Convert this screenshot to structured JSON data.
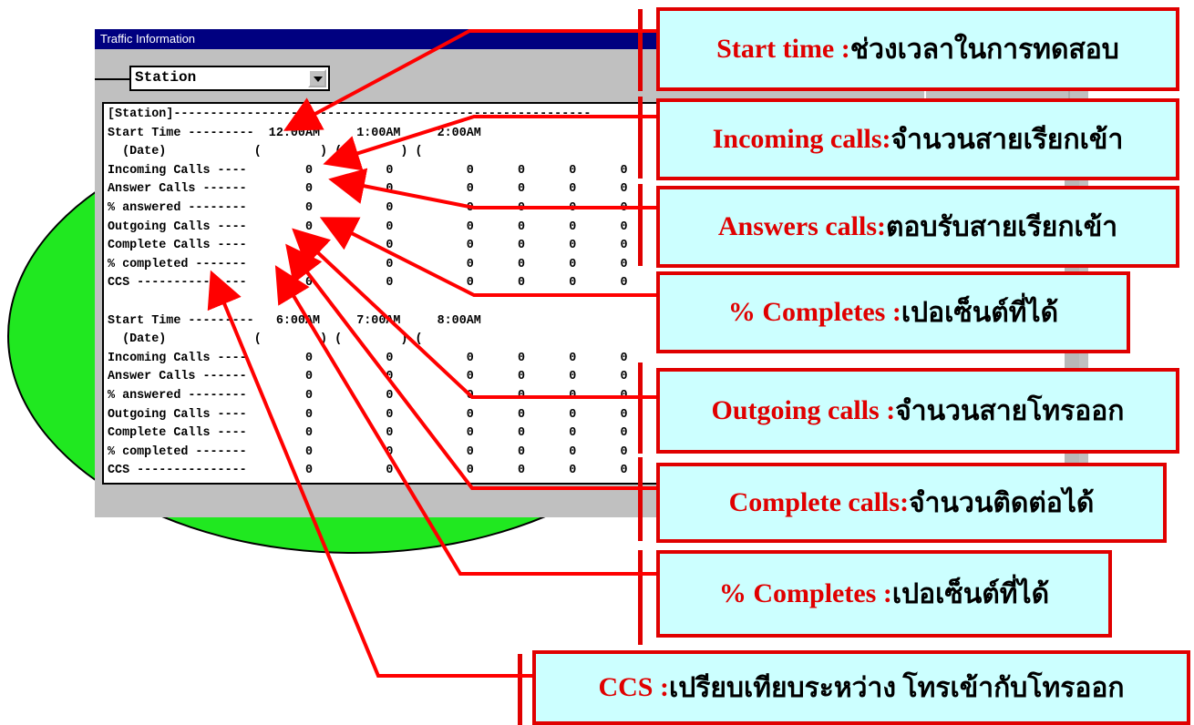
{
  "window": {
    "title": "Traffic Information",
    "station_select_value": "Station",
    "report_lines": [
      "[Station]---------------------------------------------------------",
      "Start Time ---------  12:00AM     1:00AM     2:00AM",
      "  (Date)            (        ) (        ) (",
      "Incoming Calls ----        0          0          0      0      0      0",
      "Answer Calls ------        0          0          0      0      0      0",
      "% answered --------        0          0          0      0      0      0",
      "Outgoing Calls ----        0          0          0      0      0      0",
      "Complete Calls ----        0          0          0      0      0      0",
      "% completed -------        0          0          0      0      0      0",
      "CCS ---------------        0          0          0      0      0      0",
      "",
      "Start Time ---------   6:00AM     7:00AM     8:00AM",
      "  (Date)            (        ) (        ) (",
      "Incoming Calls ----        0          0          0      0      0      0",
      "Answer Calls ------        0          0          0      0      0      0",
      "% answered --------        0          0          0      0      0      0",
      "Outgoing Calls ----        0          0          0      0      0      0",
      "Complete Calls ----        0          0          0      0      0      0",
      "% completed -------        0          0          0      0      0      0",
      "CCS ---------------        0          0          0      0      0      0"
    ]
  },
  "callouts": [
    {
      "term": "Start time :",
      "desc": " ช่วงเวลาในการทดสอบ"
    },
    {
      "term": "Incoming calls:",
      "desc": " จำนวนสายเรียกเข้า"
    },
    {
      "term": "Answers calls:",
      "desc": " ตอบรับสายเรียกเข้า"
    },
    {
      "term": "% Completes :",
      "desc": " เปอเซ็นต์ที่ได้"
    },
    {
      "term": "Outgoing calls :",
      "desc": " จำนวนสายโทรออก"
    },
    {
      "term": "Complete calls:",
      "desc": " จำนวนติดต่อได้"
    },
    {
      "term": "% Completes :",
      "desc": " เปอเซ็นต์ที่ได้"
    },
    {
      "term": "CCS :",
      "desc": " เปรียบเทียบระหว่าง โทรเข้ากับโทรออก"
    }
  ],
  "colors": {
    "callout_fill": "#ccffff",
    "callout_border": "#e00000",
    "ellipse_fill": "#20e820",
    "titlebar": "#000080"
  }
}
